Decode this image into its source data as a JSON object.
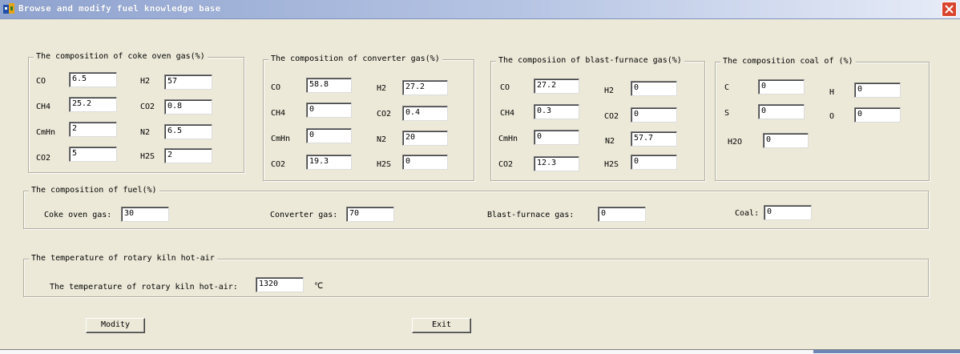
{
  "window": {
    "title": "Browse and modify fuel knowledge base",
    "close_glyph": "✕"
  },
  "coke": {
    "legend": "The composition of coke oven gas(%)",
    "fields": [
      {
        "label": "CO",
        "value": "6.5"
      },
      {
        "label": "H2",
        "value": "57"
      },
      {
        "label": "CH4",
        "value": "25.2"
      },
      {
        "label": "CO2",
        "value": "0.8"
      },
      {
        "label": "CmHn",
        "value": "2"
      },
      {
        "label": "N2",
        "value": "6.5"
      },
      {
        "label": "CO2",
        "value": "5"
      },
      {
        "label": "H2S",
        "value": "2"
      }
    ]
  },
  "converter": {
    "legend": "The composition of converter gas(%)",
    "fields": [
      {
        "label": "CO",
        "value": "58.8"
      },
      {
        "label": "H2",
        "value": "27.2"
      },
      {
        "label": "CH4",
        "value": "0"
      },
      {
        "label": "CO2",
        "value": "0.4"
      },
      {
        "label": "CmHn",
        "value": "0"
      },
      {
        "label": "N2",
        "value": "20"
      },
      {
        "label": "CO2",
        "value": "19.3"
      },
      {
        "label": "H2S",
        "value": "0"
      }
    ]
  },
  "blast": {
    "legend": "The composiion of blast-furnace gas(%)",
    "fields": [
      {
        "label": "CO",
        "value": "27.2"
      },
      {
        "label": "H2",
        "value": "0"
      },
      {
        "label": "CH4",
        "value": "0.3"
      },
      {
        "label": "CO2",
        "value": "0"
      },
      {
        "label": "CmHn",
        "value": "0"
      },
      {
        "label": "N2",
        "value": "57.7"
      },
      {
        "label": "CO2",
        "value": "12.3"
      },
      {
        "label": "H2S",
        "value": "0"
      }
    ]
  },
  "coal": {
    "legend": "The composition coal of (%)",
    "fields": [
      {
        "label": "C",
        "value": "0"
      },
      {
        "label": "H",
        "value": "0"
      },
      {
        "label": "S",
        "value": "0"
      },
      {
        "label": "O",
        "value": "0"
      },
      {
        "label": "H2O",
        "value": "0"
      }
    ]
  },
  "fuel": {
    "legend": "The composition of fuel(%)",
    "fields": [
      {
        "label": "Coke oven gas:",
        "value": "30"
      },
      {
        "label": "Converter gas:",
        "value": "70"
      },
      {
        "label": "Blast-furnace gas:",
        "value": "0"
      },
      {
        "label": "Coal:",
        "value": "0"
      }
    ]
  },
  "temperature": {
    "legend": "The temperature of  rotary kiln hot-air",
    "label": "The temperature of  rotary kiln hot-air:",
    "value": "1320",
    "unit": "℃"
  },
  "buttons": {
    "modify": "Modity",
    "exit": "Exit"
  }
}
